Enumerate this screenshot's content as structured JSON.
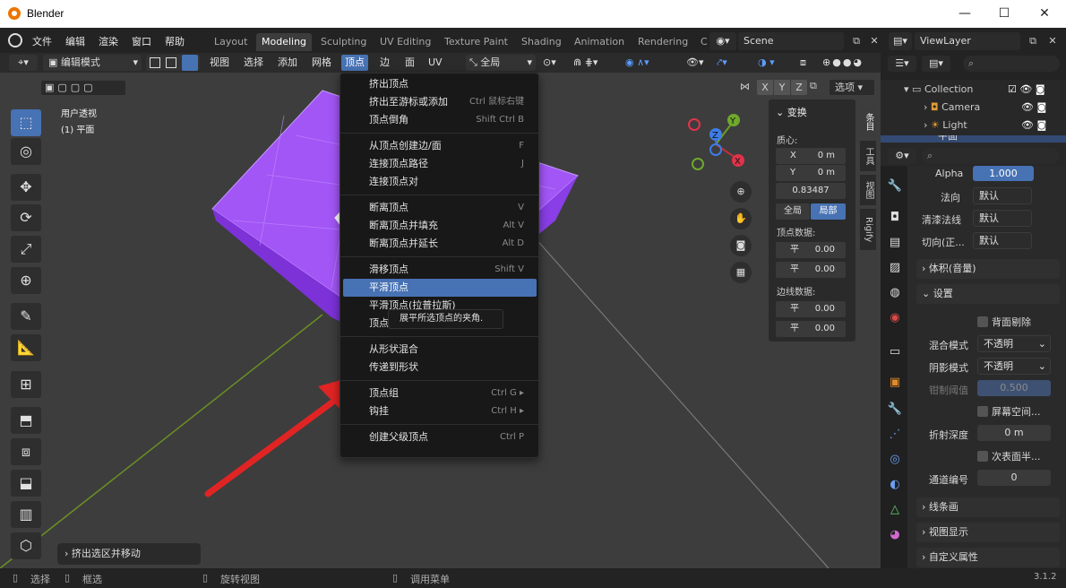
{
  "window": {
    "title": "Blender",
    "minimize": "—",
    "maximize": "☐",
    "close": "✕"
  },
  "menubar": {
    "menus": [
      "文件",
      "编辑",
      "渲染",
      "窗口",
      "帮助"
    ],
    "workspaces": [
      "Layout",
      "Modeling",
      "Sculpting",
      "UV Editing",
      "Texture Paint",
      "Shading",
      "Animation",
      "Rendering",
      "C"
    ],
    "active_workspace": "Modeling",
    "scene": "Scene",
    "view_layer": "ViewLayer"
  },
  "header": {
    "mode": "编辑模式",
    "items": [
      "视图",
      "选择",
      "添加",
      "网格",
      "顶点",
      "边",
      "面",
      "UV"
    ],
    "active_item": "顶点",
    "transform_orientation": "全局",
    "axes": [
      "X",
      "Y",
      "Z"
    ],
    "options": "选项"
  },
  "viewport": {
    "view_name": "用户透视",
    "object_name": "(1) 平面",
    "last_op": "挤出选区并移动",
    "cube_color": "#9a48f0",
    "gizmo": {
      "x": "X",
      "y": "Y",
      "z": "Z"
    }
  },
  "vertex_menu": {
    "groups": [
      [
        {
          "label": "挤出顶点",
          "shortcut": ""
        },
        {
          "label": "挤出至游标或添加",
          "shortcut": "Ctrl 鼠标右键"
        },
        {
          "label": "顶点倒角",
          "shortcut": "Shift Ctrl B"
        }
      ],
      [
        {
          "label": "从顶点创建边/面",
          "shortcut": "F"
        },
        {
          "label": "连接顶点路径",
          "shortcut": "J"
        },
        {
          "label": "连接顶点对",
          "shortcut": ""
        }
      ],
      [
        {
          "label": "断离顶点",
          "shortcut": "V"
        },
        {
          "label": "断离顶点并填充",
          "shortcut": "Alt V"
        },
        {
          "label": "断离顶点并延长",
          "shortcut": "Alt D"
        }
      ],
      [
        {
          "label": "滑移顶点",
          "shortcut": "Shift V"
        },
        {
          "label": "平滑顶点",
          "shortcut": ""
        },
        {
          "label": "平滑顶点(拉普拉斯)",
          "shortcut": ""
        },
        {
          "label": "顶点投射",
          "shortcut": ""
        }
      ],
      [
        {
          "label": "从形状混合",
          "shortcut": ""
        },
        {
          "label": "传递到形状",
          "shortcut": ""
        }
      ],
      [
        {
          "label": "顶点组",
          "shortcut": "Ctrl G"
        },
        {
          "label": "钩挂",
          "shortcut": "Ctrl H"
        }
      ],
      [
        {
          "label": "创建父级顶点",
          "shortcut": "Ctrl P"
        }
      ]
    ],
    "selected": "平滑顶点",
    "tooltip": "展平所选顶点的夹角."
  },
  "n_panel": {
    "title": "变换",
    "median_label": "质心:",
    "x_label": "X",
    "x_value": "0 m",
    "y_label": "Y",
    "y_value": "0 m",
    "z_value": "0.83487",
    "global": "全局",
    "local": "局部",
    "vertex_data": "顶点数据:",
    "edge_data": "边线数据:",
    "mean_label": "平",
    "v1": "0.00",
    "v2": "0.00",
    "e1": "0.00",
    "e2": "0.00",
    "tabs": [
      "条目",
      "工具",
      "视图",
      "Rigify"
    ]
  },
  "outliner": {
    "collection": "Collection",
    "items": [
      "Camera",
      "Light",
      "平面"
    ]
  },
  "properties": {
    "alpha_label": "Alpha",
    "alpha_value": "1.000",
    "normal_label": "法向",
    "normal_value": "默认",
    "clearcoat_label": "清漆法线",
    "clearcoat_value": "默认",
    "tangent_label": "切向(正...",
    "tangent_value": "默认",
    "volume_section": "体积(音量)",
    "settings_section": "设置",
    "backface_label": "背面剔除",
    "blend_label": "混合模式",
    "blend_value": "不透明",
    "shadow_label": "阴影模式",
    "shadow_value": "不透明",
    "clip_label": "钳制阈值",
    "clip_value": "0.500",
    "screen_space_label": "屏幕空间...",
    "refraction_label": "折射深度",
    "refraction_value": "0 m",
    "subsurface_label": "次表面半...",
    "pass_label": "通道编号",
    "pass_value": "0",
    "lineart_section": "线条画",
    "viewport_section": "视图显示",
    "custom_section": "自定义属性"
  },
  "statusbar": {
    "select": "选择",
    "box": "框选",
    "rotate": "旋转视图",
    "menu": "调用菜单",
    "version": "3.1.2"
  },
  "colors": {
    "accent": "#4772b3",
    "arrow": "#e02424",
    "cube": "#9a48f0"
  }
}
